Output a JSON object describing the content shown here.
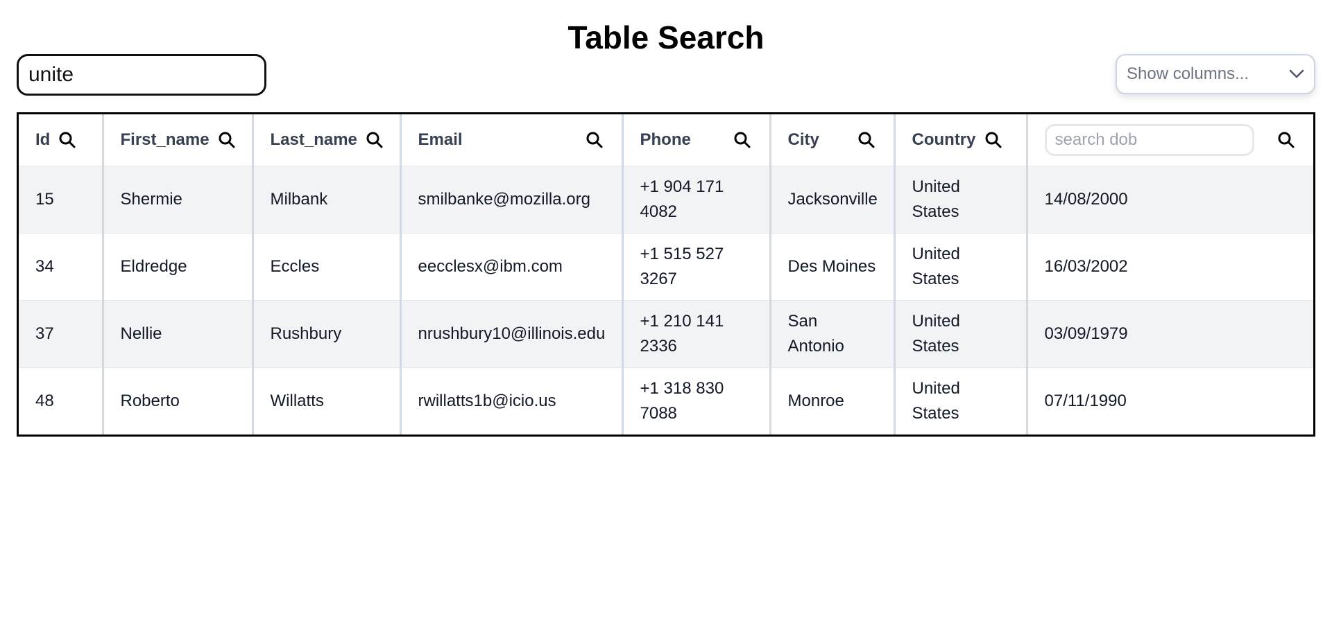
{
  "title": "Table Search",
  "global_search": {
    "value": "unite"
  },
  "column_select": {
    "placeholder": "Show columns..."
  },
  "table": {
    "headers": {
      "id": "Id",
      "first_name": "First_name",
      "last_name": "Last_name",
      "email": "Email",
      "phone": "Phone",
      "city": "City",
      "country": "Country",
      "dob_placeholder": "search dob"
    },
    "rows": [
      {
        "id": "15",
        "first_name": "Shermie",
        "last_name": "Milbank",
        "email": "smilbanke@mozilla.org",
        "phone_l1": "+1 904 171",
        "phone_l2": "4082",
        "city_l1": "Jacksonville",
        "city_l2": "",
        "country_l1": "United",
        "country_l2": "States",
        "dob": "14/08/2000"
      },
      {
        "id": "34",
        "first_name": "Eldredge",
        "last_name": "Eccles",
        "email": "eecclesx@ibm.com",
        "phone_l1": "+1 515 527",
        "phone_l2": "3267",
        "city_l1": "Des Moines",
        "city_l2": "",
        "country_l1": "United",
        "country_l2": "States",
        "dob": "16/03/2002"
      },
      {
        "id": "37",
        "first_name": "Nellie",
        "last_name": "Rushbury",
        "email": "nrushbury10@illinois.edu",
        "phone_l1": "+1 210 141",
        "phone_l2": "2336",
        "city_l1": "San",
        "city_l2": "Antonio",
        "country_l1": "United",
        "country_l2": "States",
        "dob": "03/09/1979"
      },
      {
        "id": "48",
        "first_name": "Roberto",
        "last_name": "Willatts",
        "email": "rwillatts1b@icio.us",
        "phone_l1": "+1 318 830",
        "phone_l2": "7088",
        "city_l1": "Monroe",
        "city_l2": "",
        "country_l1": "United",
        "country_l2": "States",
        "dob": "07/11/1990"
      }
    ]
  },
  "icons": {
    "column_search": "search-icon",
    "column_select_toggle": "chevron-down-icon"
  },
  "colors": {
    "zebra_row": "#f2f3f5",
    "column_divider": "#d1d9e3",
    "table_border": "#000000"
  }
}
